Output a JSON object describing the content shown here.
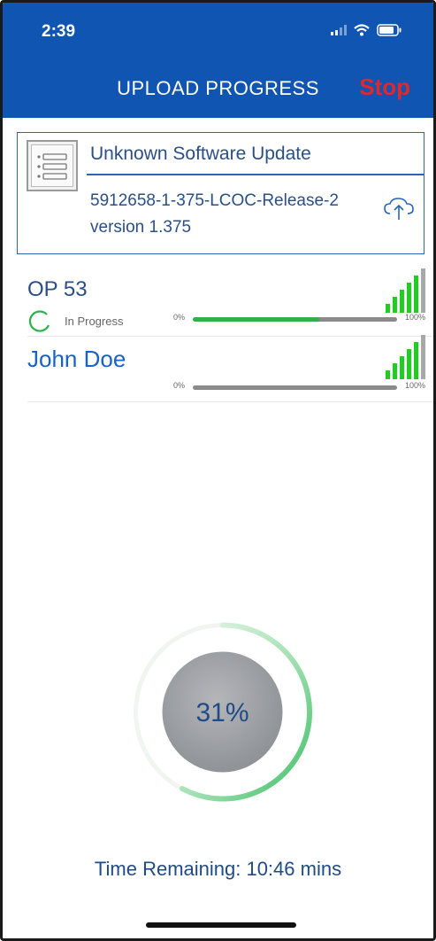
{
  "status_bar": {
    "time": "2:39"
  },
  "header": {
    "title": "UPLOAD PROGRESS",
    "stop_label": "Stop"
  },
  "package": {
    "title": "Unknown Software Update",
    "name": "5912658-1-375-LCOC-Release-2",
    "version": "version 1.375"
  },
  "devices": [
    {
      "name": "OP 53",
      "status": "In Progress",
      "progress": 0.62,
      "min_label": "0%",
      "max_label": "100%",
      "signal_bars": 5,
      "signal_total": 6
    },
    {
      "name": "John Doe",
      "status": "",
      "progress": 0.0,
      "min_label": "0%",
      "max_label": "100%",
      "signal_bars": 5,
      "signal_total": 6
    }
  ],
  "overall": {
    "percent_label": "31%",
    "percent": 0.31,
    "time_remaining": "Time Remaining: 10:46 mins"
  },
  "colors": {
    "header": "#0f55b1",
    "stop": "#e3262b",
    "progress": "#2bb24c",
    "signal_on": "#22cc22",
    "signal_off": "#a8a8a8"
  }
}
